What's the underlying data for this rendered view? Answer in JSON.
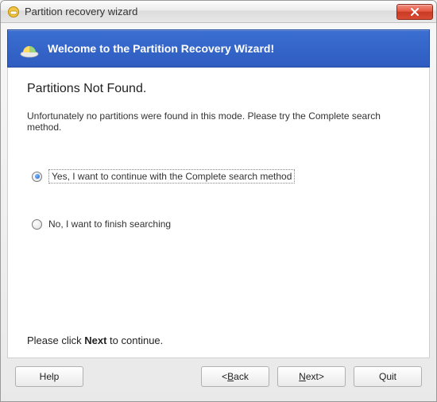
{
  "window": {
    "title": "Partition recovery wizard"
  },
  "banner": {
    "text": "Welcome to the Partition Recovery Wizard!"
  },
  "page": {
    "heading": "Partitions Not Found.",
    "body": "Unfortunately no partitions were found in this mode. Please try the Complete search method."
  },
  "options": [
    {
      "label": "Yes, I want to continue with the Complete search method",
      "selected": true
    },
    {
      "label": "No, I want to finish searching",
      "selected": false
    }
  ],
  "hint": {
    "prefix": "Please click ",
    "bold": "Next",
    "suffix": " to continue."
  },
  "buttons": {
    "help": "Help",
    "back": "Back",
    "next": "Next",
    "quit": "Quit"
  }
}
